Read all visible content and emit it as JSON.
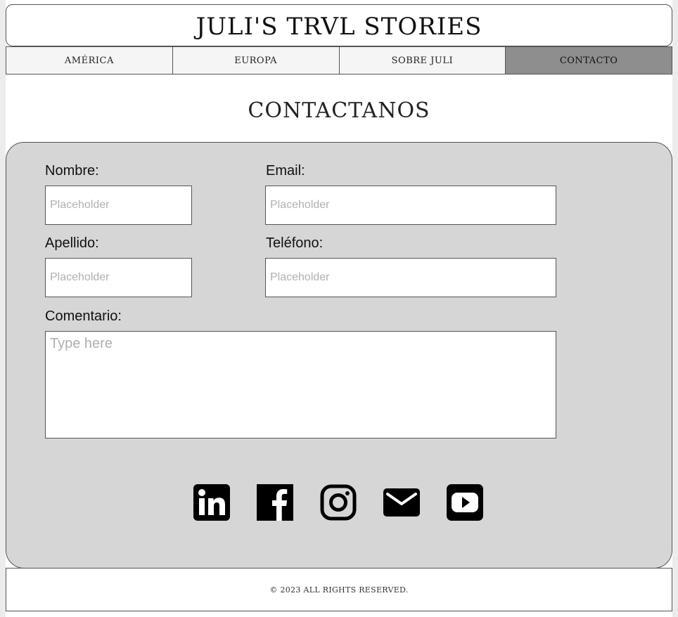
{
  "header": {
    "title": "JULI'S TRVL STORIES"
  },
  "nav": {
    "items": [
      {
        "label": "AMÉRICA"
      },
      {
        "label": "EUROPA"
      },
      {
        "label": "SOBRE JULI"
      },
      {
        "label": "CONTACTO"
      }
    ]
  },
  "section": {
    "title": "CONTACTANOS"
  },
  "form": {
    "nombre": {
      "label": "Nombre:",
      "placeholder": "Placeholder",
      "value": ""
    },
    "email": {
      "label": "Email:",
      "placeholder": "Placeholder",
      "value": ""
    },
    "apellido": {
      "label": "Apellido:",
      "placeholder": "Placeholder",
      "value": ""
    },
    "telefono": {
      "label": "Teléfono:",
      "placeholder": "Placeholder",
      "value": ""
    },
    "comentario": {
      "label": "Comentario:",
      "placeholder": "Type here",
      "value": ""
    }
  },
  "social": {
    "icons": [
      "linkedin-icon",
      "facebook-icon",
      "instagram-icon",
      "mail-icon",
      "youtube-icon"
    ]
  },
  "footer": {
    "text": "© 2023  ALL RIGHTS RESERVED."
  },
  "colors": {
    "panel_bg": "#d6d6d6",
    "active_nav_bg": "#8e8e8e",
    "nav_bg": "#f5f5f5",
    "icon": "#000000"
  }
}
